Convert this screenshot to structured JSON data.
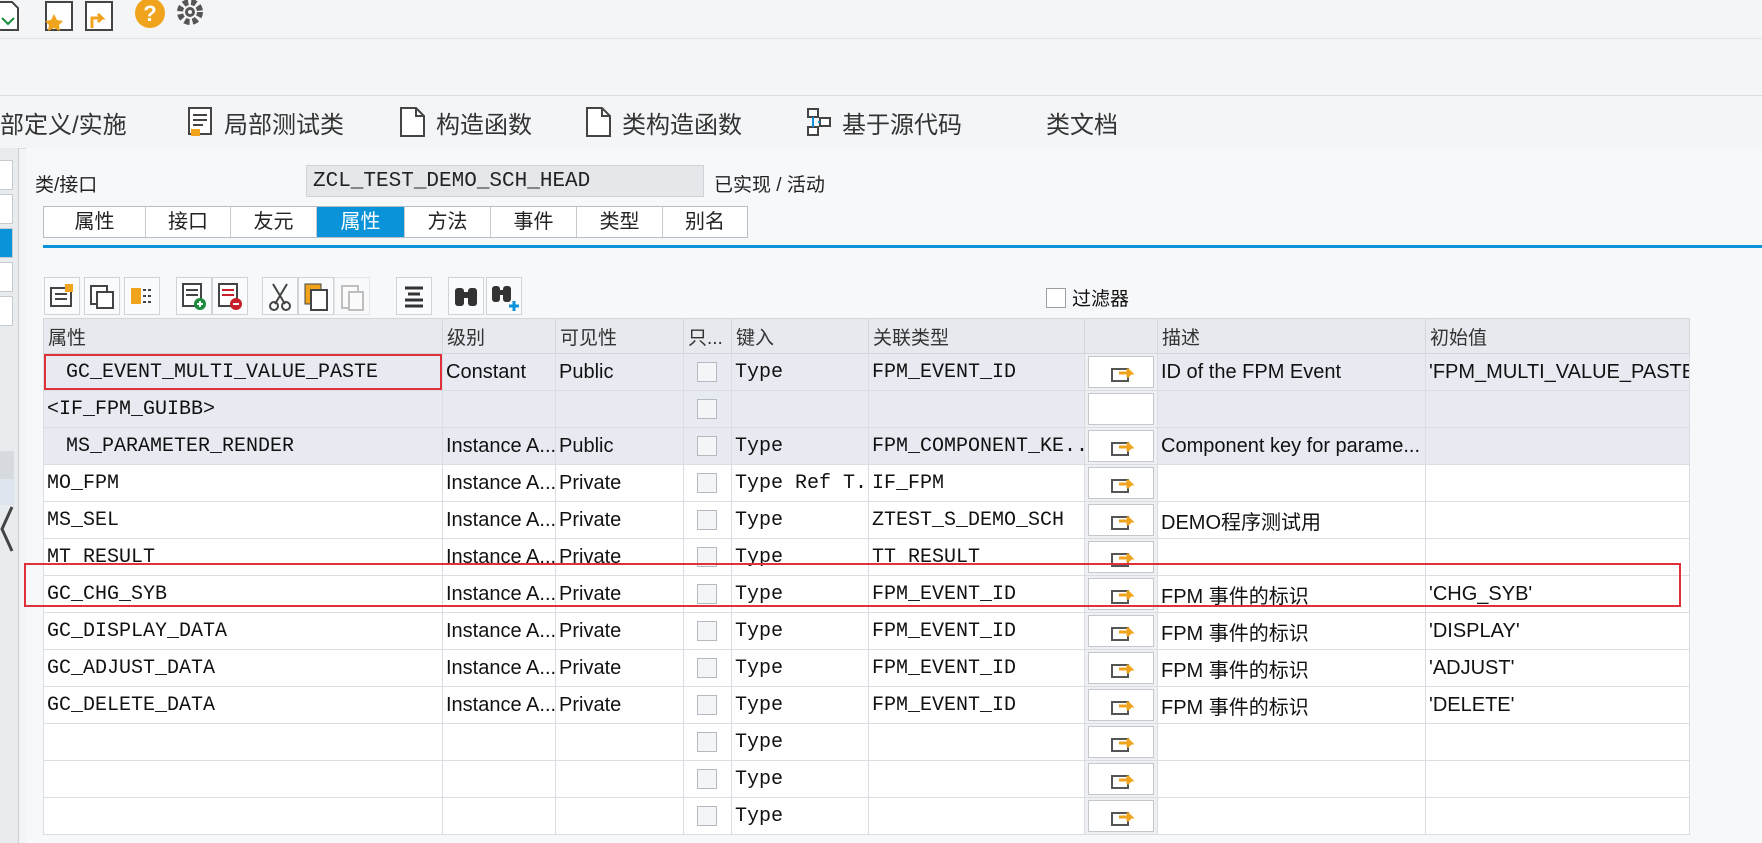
{
  "toolbar": {
    "icons": [
      "document-icon",
      "favorite-star-icon",
      "export-icon",
      "help-icon",
      "settings-gear-icon"
    ]
  },
  "function_tabs": [
    {
      "label": "部定义/实施",
      "icon": ""
    },
    {
      "label": "局部测试类",
      "icon": "test-class-icon"
    },
    {
      "label": "构造函数",
      "icon": "document-icon"
    },
    {
      "label": "类构造函数",
      "icon": "document-icon"
    },
    {
      "label": "基于源代码",
      "icon": "source-code-icon"
    },
    {
      "label": "类文档",
      "icon": ""
    }
  ],
  "class_header": {
    "label": "类/接口",
    "value": "ZCL_TEST_DEMO_SCH_HEAD",
    "status": "已实现 / 活动"
  },
  "tabs": [
    "属性",
    "接口",
    "友元",
    "属性",
    "方法",
    "事件",
    "类型",
    "别名"
  ],
  "active_tab_index": 3,
  "filter_label": "过滤器",
  "table": {
    "columns": [
      "属性",
      "级别",
      "可见性",
      "只...",
      "键入",
      "关联类型",
      "",
      "描述",
      "初始值"
    ],
    "rows": [
      {
        "attr": "GC_EVENT_MULTI_VALUE_PASTE",
        "indent": true,
        "level": "Constant",
        "vis": "Public",
        "typing": "Type",
        "assoc": "FPM_EVENT_ID",
        "nav": true,
        "desc": "ID of the FPM Event",
        "init": "'FPM_MULTI_VALUE_PASTE'",
        "selected": true
      },
      {
        "attr": "<IF_FPM_GUIBB>",
        "indent": false,
        "level": "",
        "vis": "",
        "typing": "",
        "assoc": "",
        "nav": false,
        "desc": "",
        "init": "",
        "selected": true
      },
      {
        "attr": "MS_PARAMETER_RENDER",
        "indent": true,
        "level": "Instance A...",
        "vis": "Public",
        "typing": "Type",
        "assoc": "FPM_COMPONENT_KE...",
        "nav": true,
        "desc": "Component key for parame...",
        "init": "",
        "selected": true
      },
      {
        "attr": "MO_FPM",
        "indent": false,
        "level": "Instance A...",
        "vis": "Private",
        "typing": "Type Ref T...",
        "assoc": "IF_FPM",
        "nav": true,
        "desc": "",
        "init": "",
        "selected": false
      },
      {
        "attr": "MS_SEL",
        "indent": false,
        "level": "Instance A...",
        "vis": "Private",
        "typing": "Type",
        "assoc": "ZTEST_S_DEMO_SCH",
        "nav": true,
        "desc": "DEMO程序测试用",
        "init": "",
        "selected": false
      },
      {
        "attr": "MT_RESULT",
        "indent": false,
        "level": "Instance A...",
        "vis": "Private",
        "typing": "Type",
        "assoc": "TT_RESULT",
        "nav": true,
        "desc": "",
        "init": "",
        "selected": false
      },
      {
        "attr": "GC_CHG_SYB",
        "indent": false,
        "level": "Instance A...",
        "vis": "Private",
        "typing": "Type",
        "assoc": "FPM_EVENT_ID",
        "nav": true,
        "desc": "FPM 事件的标识",
        "init": "'CHG_SYB'",
        "selected": false
      },
      {
        "attr": "GC_DISPLAY_DATA",
        "indent": false,
        "level": "Instance A...",
        "vis": "Private",
        "typing": "Type",
        "assoc": "FPM_EVENT_ID",
        "nav": true,
        "desc": "FPM 事件的标识",
        "init": "'DISPLAY'",
        "selected": false
      },
      {
        "attr": "GC_ADJUST_DATA",
        "indent": false,
        "level": "Instance A...",
        "vis": "Private",
        "typing": "Type",
        "assoc": "FPM_EVENT_ID",
        "nav": true,
        "desc": "FPM 事件的标识",
        "init": "'ADJUST'",
        "selected": false
      },
      {
        "attr": "GC_DELETE_DATA",
        "indent": false,
        "level": "Instance A...",
        "vis": "Private",
        "typing": "Type",
        "assoc": "FPM_EVENT_ID",
        "nav": true,
        "desc": "FPM 事件的标识",
        "init": "'DELETE'",
        "selected": false
      },
      {
        "attr": "",
        "indent": false,
        "level": "",
        "vis": "",
        "typing": "Type",
        "assoc": "",
        "nav": true,
        "desc": "",
        "init": "",
        "selected": false
      },
      {
        "attr": "",
        "indent": false,
        "level": "",
        "vis": "",
        "typing": "Type",
        "assoc": "",
        "nav": true,
        "desc": "",
        "init": "",
        "selected": false
      },
      {
        "attr": "",
        "indent": false,
        "level": "",
        "vis": "",
        "typing": "Type",
        "assoc": "",
        "nav": true,
        "desc": "",
        "init": "",
        "selected": false
      }
    ]
  },
  "colors": {
    "accent": "#0a93d8",
    "highlight": "#e0303a",
    "icon_orange": "#f0a31c"
  }
}
